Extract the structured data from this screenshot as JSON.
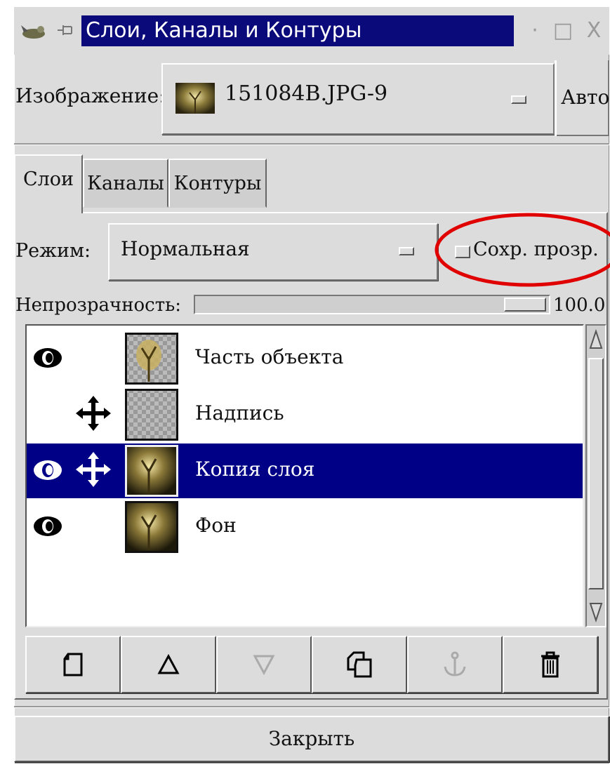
{
  "window": {
    "title": "Слои, Каналы и Контуры",
    "controls": {
      "minimize": "·",
      "maximize": "□",
      "close": "X"
    }
  },
  "image_selector": {
    "label": "Изображение:",
    "value": "151084B.JPG-9",
    "auto_button": "Авто"
  },
  "tabs": [
    {
      "label": "Слои",
      "active": true
    },
    {
      "label": "Каналы",
      "active": false
    },
    {
      "label": "Контуры",
      "active": false
    }
  ],
  "mode": {
    "label": "Режим:",
    "value": "Нормальная",
    "keep_transparency": "Сохр. прозр.",
    "keep_transparency_checked": false
  },
  "opacity": {
    "label": "Непрозрачность:",
    "value": "100.0"
  },
  "layers": [
    {
      "name": "Часть объекта",
      "visible": true,
      "linked": false,
      "selected": false
    },
    {
      "name": "Надпись",
      "visible": false,
      "linked": true,
      "selected": false
    },
    {
      "name": "Копия слоя",
      "visible": true,
      "linked": true,
      "selected": true
    },
    {
      "name": "Фон",
      "visible": true,
      "linked": false,
      "selected": false
    }
  ],
  "buttons": [
    {
      "icon": "new-layer-icon",
      "enabled": true
    },
    {
      "icon": "raise-layer-icon",
      "enabled": true
    },
    {
      "icon": "lower-layer-icon",
      "enabled": false
    },
    {
      "icon": "duplicate-layer-icon",
      "enabled": true
    },
    {
      "icon": "anchor-icon",
      "enabled": false
    },
    {
      "icon": "trash-icon",
      "enabled": true
    }
  ],
  "close_button": "Закрыть",
  "colors": {
    "title_bg": "#0a0a7a",
    "selection_bg": "#000087",
    "highlight": "#e00000",
    "panel_bg": "#dcdcdc"
  }
}
